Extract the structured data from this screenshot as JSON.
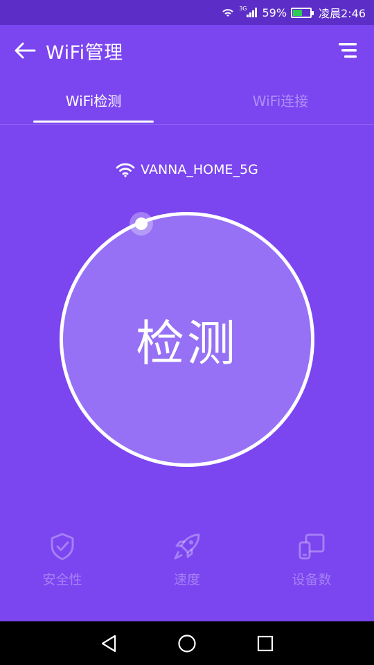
{
  "status_bar": {
    "network_type": "3G",
    "battery_percent": "59%",
    "time": "凌晨2:46",
    "battery_level": 0.59
  },
  "app_bar": {
    "title": "WiFi管理",
    "back_icon": "arrow-left-icon",
    "menu_icon": "menu-icon"
  },
  "tabs": [
    {
      "label": "WiFi检测",
      "active": true
    },
    {
      "label": "WiFi连接",
      "active": false
    }
  ],
  "network": {
    "ssid": "VANNA_HOME_5G",
    "icon": "wifi-icon"
  },
  "detect_button": {
    "label": "检测"
  },
  "features": [
    {
      "label": "安全性",
      "icon": "shield-check-icon"
    },
    {
      "label": "速度",
      "icon": "rocket-icon"
    },
    {
      "label": "设备数",
      "icon": "devices-icon"
    }
  ],
  "colors": {
    "background": "#7b45f0",
    "status_bar": "#5c2ec7",
    "circle_fill": "#9670f5",
    "battery_fill": "#2ecc55"
  }
}
